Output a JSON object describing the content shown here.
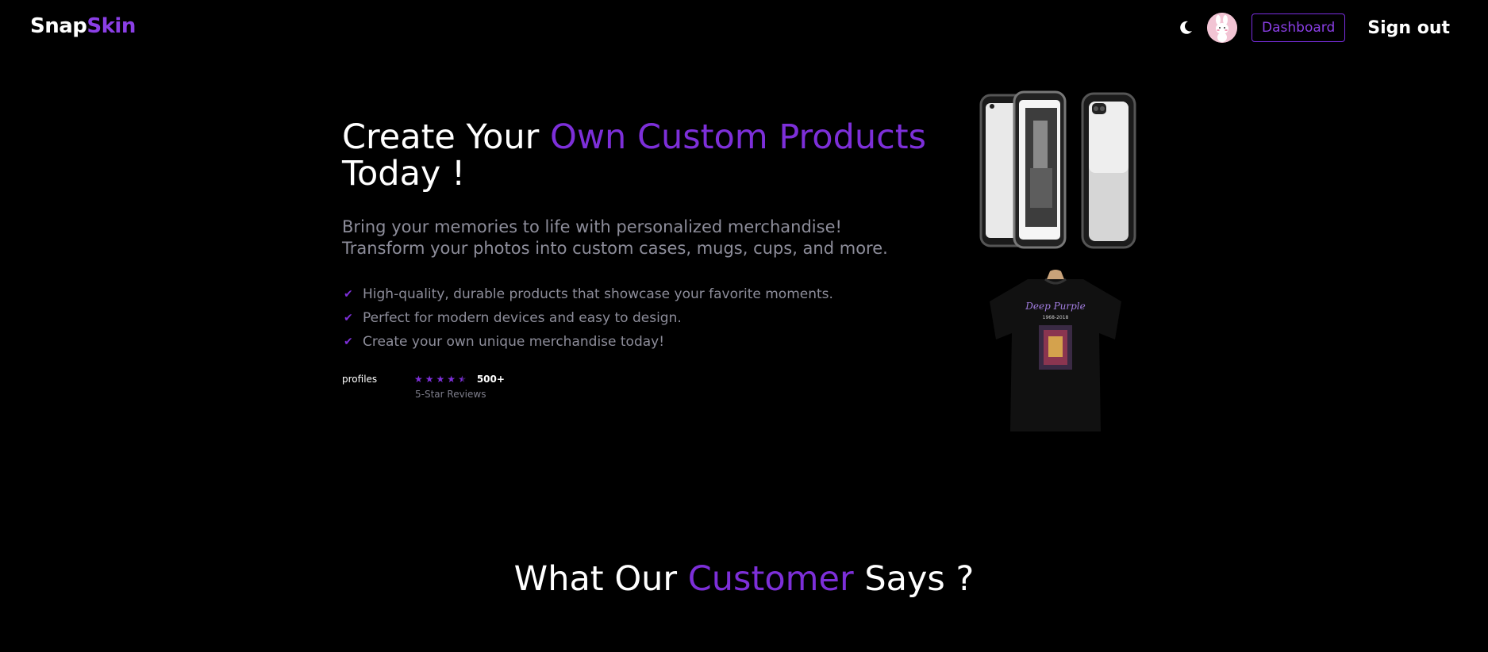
{
  "nav": {
    "logo_a": "Snap",
    "logo_b": "Skin",
    "dashboard_label": "Dashboard",
    "signout_label": "Sign out",
    "theme_icon": "moon-icon",
    "avatar_icon": "bunny-avatar"
  },
  "hero": {
    "title_part1": "Create Your ",
    "title_accent": "Own Custom Products",
    "title_part2": "Today !",
    "subtitle_line1": "Bring your memories to life with personalized merchandise!",
    "subtitle_line2": "Transform your photos into custom cases, mugs, cups, and more.",
    "features": [
      "High-quality, durable products that showcase your favorite moments.",
      "Perfect for modern devices and easy to design.",
      "Create your own unique merchandise today!"
    ],
    "profiles_alt": "profiles",
    "rating_stars": 4.5,
    "review_count": "500+",
    "review_label": "5-Star Reviews",
    "shirt_text": "Deep Purple",
    "shirt_years": "1968-2018"
  },
  "testimonials": {
    "title_part1": "What Our ",
    "title_accent": "Customer",
    "title_part2": " Says ?"
  },
  "colors": {
    "accent": "#7d2fd9",
    "background": "#000000",
    "muted_text": "#8d8d9a"
  }
}
